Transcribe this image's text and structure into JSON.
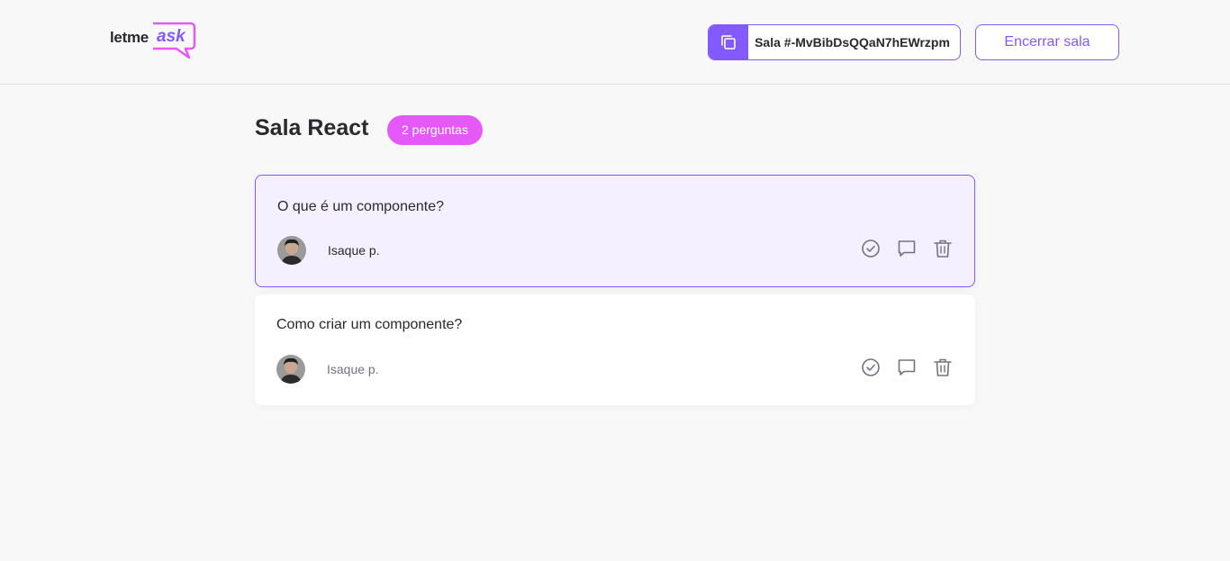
{
  "header": {
    "logo": {
      "word_primary": "letme",
      "word_accent": "ask"
    },
    "room_code_label": "Sala #-MvBibDsQQaN7hEWrzpm",
    "end_room_label": "Encerrar sala"
  },
  "room": {
    "title": "Sala React",
    "question_count_label": "2 perguntas"
  },
  "questions": [
    {
      "text": "O que é um componente?",
      "author": "Isaque p.",
      "highlighted": true,
      "actions": [
        "check-circle-icon",
        "answer-icon",
        "trash-icon"
      ]
    },
    {
      "text": "Como criar um componente?",
      "author": "Isaque p.",
      "highlighted": false,
      "actions": [
        "check-circle-icon",
        "answer-icon",
        "trash-icon"
      ]
    }
  ],
  "colors": {
    "accent": "#835afd",
    "badge": "#e559f9",
    "highlight_bg": "#f4f0ff",
    "background": "#f8f8f8"
  }
}
